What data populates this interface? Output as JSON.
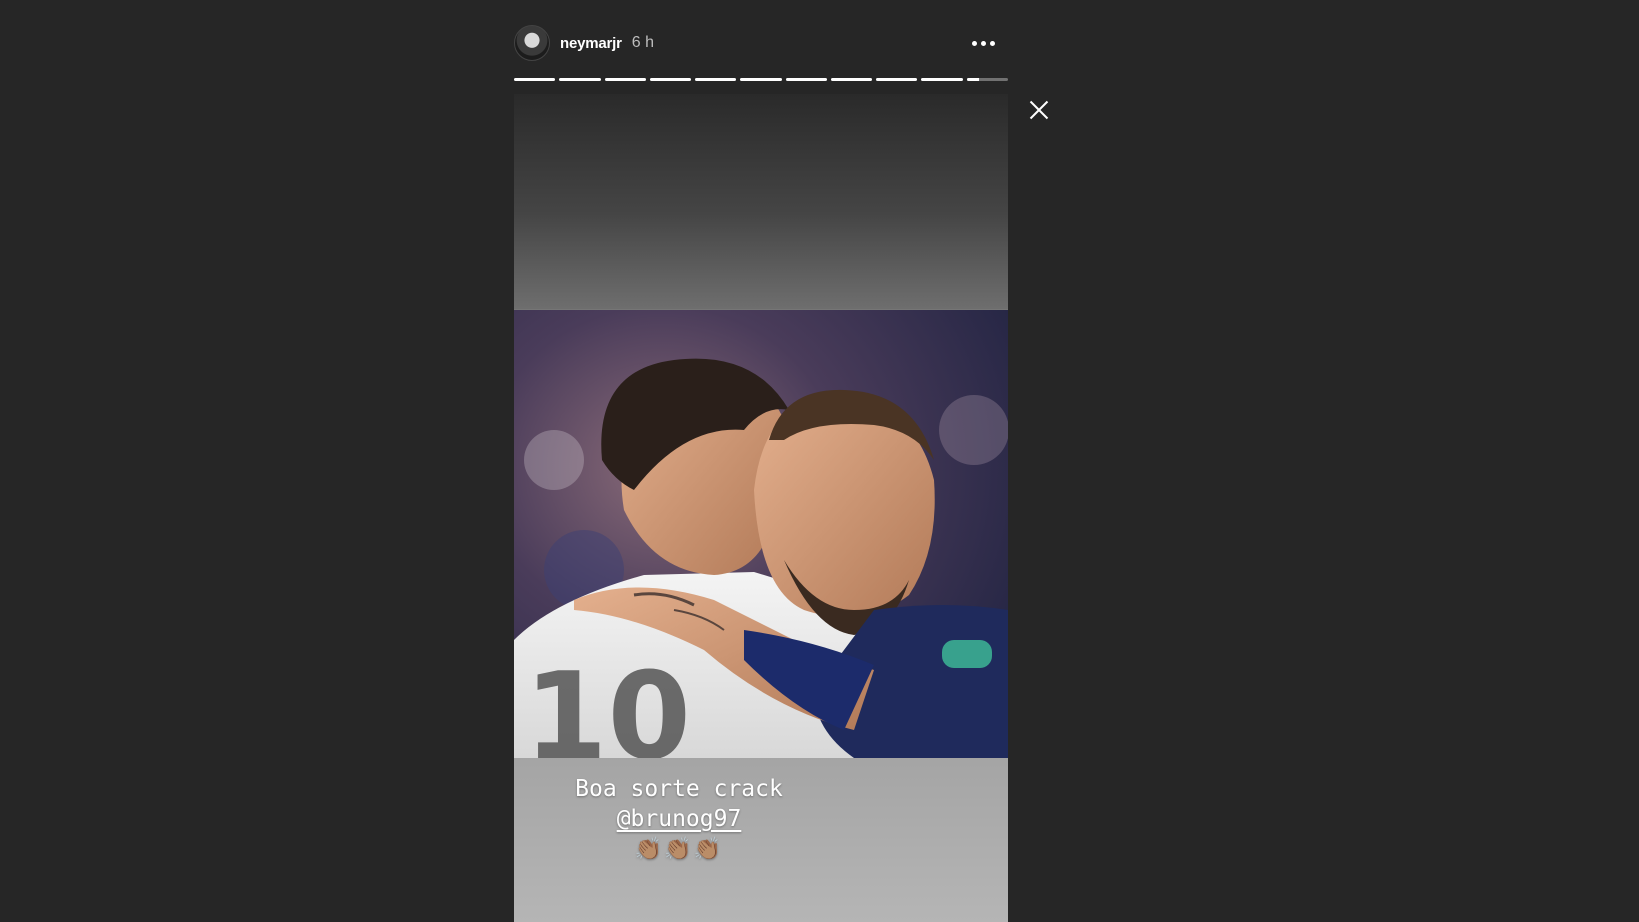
{
  "story": {
    "username": "neymarjr",
    "time_ago": "6 h",
    "progress_segments": [
      1,
      1,
      1,
      1,
      1,
      1,
      1,
      1,
      1,
      1,
      0.3
    ],
    "caption": {
      "line1": "Boa sorte crack",
      "mention": "@brunog97",
      "emojis": "👏🏽👏🏽👏🏽"
    }
  },
  "icons": {
    "more": "more-options-icon",
    "close": "close-icon",
    "avatar": "profile-avatar"
  },
  "colors": {
    "background": "#262626",
    "progress_filled": "#ffffff",
    "progress_empty": "rgba(255,255,255,0.35)"
  }
}
